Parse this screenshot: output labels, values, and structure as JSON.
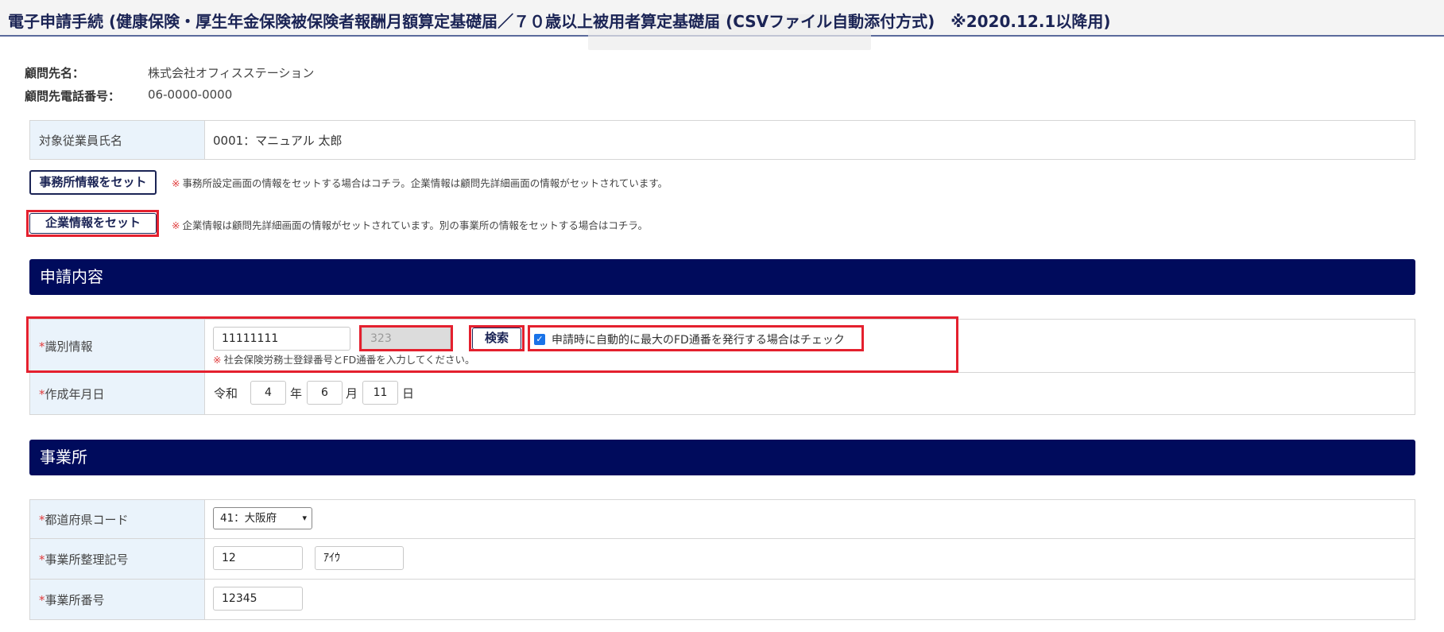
{
  "header": {
    "title": "電子申請手続 (健康保険・厚生年金保険被保険者報酬月額算定基礎届／７０歳以上被用者算定基礎届 (CSVファイル自動添付方式)　※2020.12.1以降用)"
  },
  "client": {
    "name_label": "顧問先名：",
    "name_value": "株式会社オフィスステーション",
    "phone_label": "顧問先電話番号：",
    "phone_value": "06-0000-0000"
  },
  "employee": {
    "label": "対象従業員氏名",
    "value": "0001：マニュアル 太郎"
  },
  "office_button": {
    "label": "事務所情報をセット",
    "note_mark": "※",
    "note": "事務所設定画面の情報をセットする場合はコチラ。企業情報は顧問先詳細画面の情報がセットされています。"
  },
  "company_button": {
    "label": "企業情報をセット",
    "note_mark": "※",
    "note": "企業情報は顧問先詳細画面の情報がセットされています。別の事業所の情報をセットする場合はコチラ。"
  },
  "section_application": {
    "title": "申請内容"
  },
  "identification": {
    "required_mark": "*",
    "label": "識別情報",
    "reg_number": "11111111",
    "fd_number": "323",
    "search_label": "検索",
    "checkbox_checked": true,
    "checkbox_label": "申請時に自動的に最大のFD通番を発行する場合はチェック",
    "note_mark": "※",
    "note": "社会保険労務士登録番号とFD通番を入力してください。"
  },
  "created_date": {
    "required_mark": "*",
    "label": "作成年月日",
    "era": "令和",
    "year": "4",
    "year_unit": "年",
    "month": "6",
    "month_unit": "月",
    "day": "11",
    "day_unit": "日"
  },
  "section_office": {
    "title": "事業所"
  },
  "prefecture": {
    "required_mark": "*",
    "label": "都道府県コード",
    "selected": "41：大阪府"
  },
  "office_mgmt": {
    "required_mark": "*",
    "label": "事業所整理記号",
    "value1": "12",
    "value2": "ｱｲｳ"
  },
  "office_number": {
    "required_mark": "*",
    "label": "事業所番号",
    "value": "12345"
  },
  "colors": {
    "navy": "#000b5c",
    "label_bg": "#eaf3fb",
    "highlight_red": "#e4202e",
    "required_red": "#e03c3c",
    "checkbox_blue": "#1a73e8"
  }
}
